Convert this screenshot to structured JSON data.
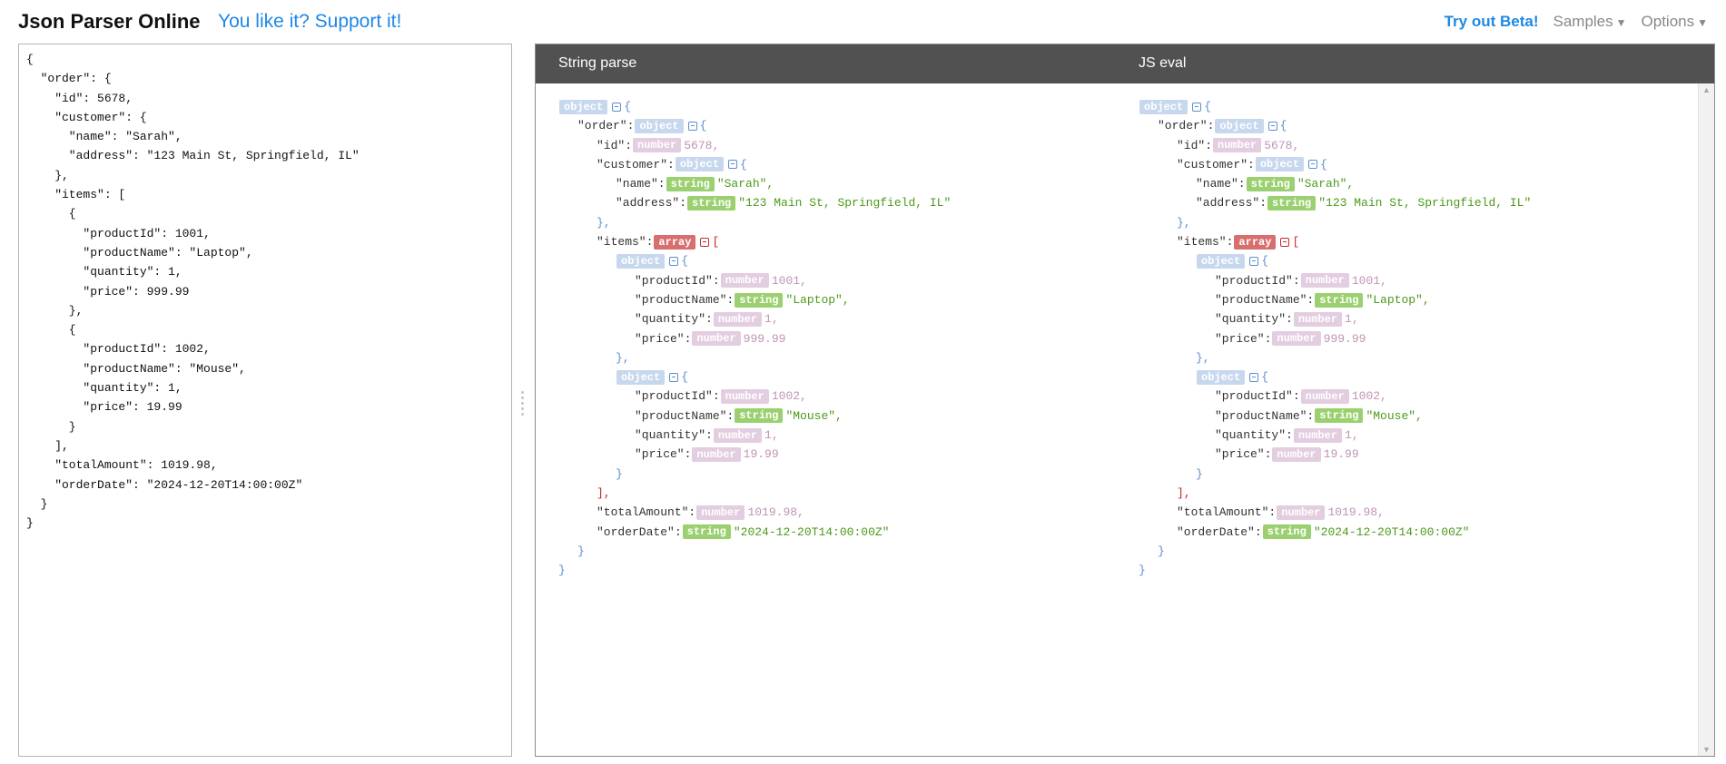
{
  "header": {
    "title": "Json Parser Online",
    "support_link": "You like it? Support it!",
    "beta_link": "Try out Beta!",
    "samples_label": "Samples",
    "options_label": "Options"
  },
  "editor": {
    "content": "{\n  \"order\": {\n    \"id\": 5678,\n    \"customer\": {\n      \"name\": \"Sarah\",\n      \"address\": \"123 Main St, Springfield, IL\"\n    },\n    \"items\": [\n      {\n        \"productId\": 1001,\n        \"productName\": \"Laptop\",\n        \"quantity\": 1,\n        \"price\": 999.99\n      },\n      {\n        \"productId\": 1002,\n        \"productName\": \"Mouse\",\n        \"quantity\": 1,\n        \"price\": 19.99\n      }\n    ],\n    \"totalAmount\": 1019.98,\n    \"orderDate\": \"2024-12-20T14:00:00Z\"\n  }\n}"
  },
  "viewer": {
    "left_title": "String parse",
    "right_title": "JS eval",
    "tree": [
      {
        "indent": 0,
        "type": "object",
        "open": "{",
        "toggle": "blue"
      },
      {
        "indent": 1,
        "key": "order",
        "type": "object",
        "open": "{",
        "toggle": "blue"
      },
      {
        "indent": 2,
        "key": "id",
        "type": "number",
        "value": "5678",
        "comma": true
      },
      {
        "indent": 2,
        "key": "customer",
        "type": "object",
        "open": "{",
        "toggle": "blue"
      },
      {
        "indent": 3,
        "key": "name",
        "type": "string",
        "value": "\"Sarah\"",
        "comma": true
      },
      {
        "indent": 3,
        "key": "address",
        "type": "string",
        "value": "\"123 Main St, Springfield, IL\""
      },
      {
        "indent": 2,
        "close": "}",
        "comma": true
      },
      {
        "indent": 2,
        "key": "items",
        "type": "array",
        "open": "[",
        "toggle": "red"
      },
      {
        "indent": 3,
        "type": "object",
        "open": "{",
        "toggle": "blue"
      },
      {
        "indent": 4,
        "key": "productId",
        "type": "number",
        "value": "1001",
        "comma": true
      },
      {
        "indent": 4,
        "key": "productName",
        "type": "string",
        "value": "\"Laptop\"",
        "comma": true
      },
      {
        "indent": 4,
        "key": "quantity",
        "type": "number",
        "value": "1",
        "comma": true
      },
      {
        "indent": 4,
        "key": "price",
        "type": "number",
        "value": "999.99"
      },
      {
        "indent": 3,
        "close": "}",
        "comma": true
      },
      {
        "indent": 3,
        "type": "object",
        "open": "{",
        "toggle": "blue"
      },
      {
        "indent": 4,
        "key": "productId",
        "type": "number",
        "value": "1002",
        "comma": true
      },
      {
        "indent": 4,
        "key": "productName",
        "type": "string",
        "value": "\"Mouse\"",
        "comma": true
      },
      {
        "indent": 4,
        "key": "quantity",
        "type": "number",
        "value": "1",
        "comma": true
      },
      {
        "indent": 4,
        "key": "price",
        "type": "number",
        "value": "19.99"
      },
      {
        "indent": 3,
        "close": "}"
      },
      {
        "indent": 2,
        "close": "]",
        "comma": true,
        "close_color": "red"
      },
      {
        "indent": 2,
        "key": "totalAmount",
        "type": "number",
        "value": "1019.98",
        "comma": true
      },
      {
        "indent": 2,
        "key": "orderDate",
        "type": "string",
        "value": "\"2024-12-20T14:00:00Z\""
      },
      {
        "indent": 1,
        "close": "}"
      },
      {
        "indent": 0,
        "close": "}"
      }
    ]
  },
  "colors": {
    "link": "#1e88e5",
    "header_bar": "#515151",
    "tag_object": "#c7d8ee",
    "tag_number": "#e3cde0",
    "tag_string": "#9bd070",
    "tag_array": "#d86f6f",
    "value_string": "#4c9a1a",
    "value_number": "#c094b4"
  }
}
